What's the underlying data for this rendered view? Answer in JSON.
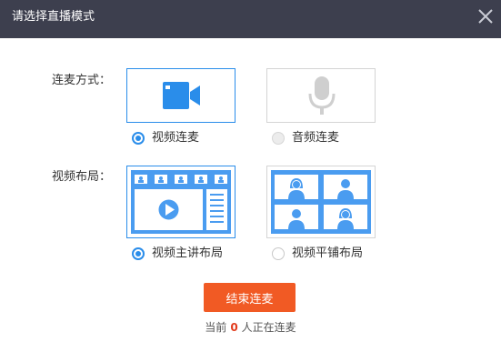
{
  "dialog": {
    "title": "请选择直播模式",
    "close_icon": "close-icon"
  },
  "connect_mode": {
    "label": "连麦方式：",
    "options": [
      {
        "label": "视频连麦",
        "icon": "video-camera-icon",
        "selected": true
      },
      {
        "label": "音频连麦",
        "icon": "microphone-icon",
        "selected": false
      }
    ]
  },
  "video_layout": {
    "label": "视频布局：",
    "options": [
      {
        "label": "视频主讲布局",
        "icon": "presenter-layout-icon",
        "selected": true
      },
      {
        "label": "视频平铺布局",
        "icon": "tiled-layout-icon",
        "selected": false
      }
    ]
  },
  "actions": {
    "end_label": "结束连麦"
  },
  "status": {
    "prefix": "当前",
    "count": "0",
    "suffix": "人正在连麦"
  },
  "colors": {
    "titlebar": "#3d3f4e",
    "accent": "#2a8dea",
    "tile_blue": "#4a9cf0",
    "end_button": "#f15a24",
    "count_red": "#e23b1d"
  }
}
